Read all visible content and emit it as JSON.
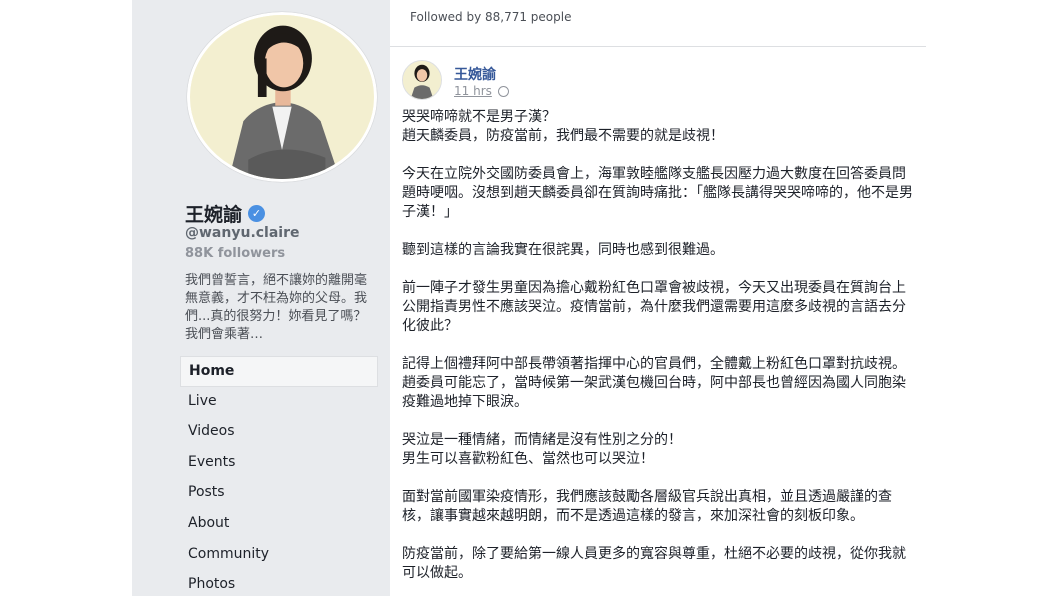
{
  "profile": {
    "name": "王婉諭",
    "verified_mark": "✓",
    "handle": "@wanyu.claire",
    "followers": "88K followers",
    "about": "我們曾誓言，絕不讓妳的離開毫無意義，才不枉為妳的父母。我們...真的很努力！妳看見了嗎？ 我們會乘著…"
  },
  "nav": [
    {
      "label": "Home"
    },
    {
      "label": "Live"
    },
    {
      "label": "Videos"
    },
    {
      "label": "Events"
    },
    {
      "label": "Posts"
    },
    {
      "label": "About"
    },
    {
      "label": "Community"
    },
    {
      "label": "Photos"
    }
  ],
  "feed": {
    "followed_by": "Followed by 88,771 people"
  },
  "post": {
    "author": "王婉諭",
    "time": "11 hrs",
    "paragraphs": [
      "哭哭啼啼就不是男子漢？\n趙天麟委員，防疫當前，我們最不需要的就是歧視！",
      "今天在立院外交國防委員會上，海軍敦睦艦隊支艦長因壓力過大數度在回答委員問題時哽咽。沒想到趙天麟委員卻在質詢時痛批：「艦隊長講得哭哭啼啼的，他不是男子漢！」",
      "聽到這樣的言論我實在很詫異，同時也感到很難過。",
      "前一陣子才發生男童因為擔心戴粉紅色口罩會被歧視，今天又出現委員在質詢台上公開指責男性不應該哭泣。疫情當前，為什麼我們還需要用這麼多歧視的言語去分化彼此？",
      "記得上個禮拜阿中部長帶領著指揮中心的官員們，全體戴上粉紅色口罩對抗歧視。趙委員可能忘了，當時候第一架武漢包機回台時，阿中部長也曾經因為國人同胞染疫難過地掉下眼淚。",
      "哭泣是一種情緒，而情緒是沒有性別之分的！\n男生可以喜歡粉紅色、當然也可以哭泣！",
      "面對當前國軍染疫情形，我們應該鼓勵各層級官兵說出真相，並且透過嚴謹的查核，讓事實越來越明朗，而不是透過這樣的發言，來加深社會的刻板印象。",
      "防疫當前，除了要給第一線人員更多的寬容與尊重，杜絕不必要的歧視，從你我就可以做起。"
    ]
  },
  "icons": {
    "verified": "verified-badge-icon",
    "globe": "globe-icon"
  },
  "colors": {
    "link": "#365899",
    "verified": "#4a90e2",
    "sidebar_bg": "#e9ebee"
  }
}
